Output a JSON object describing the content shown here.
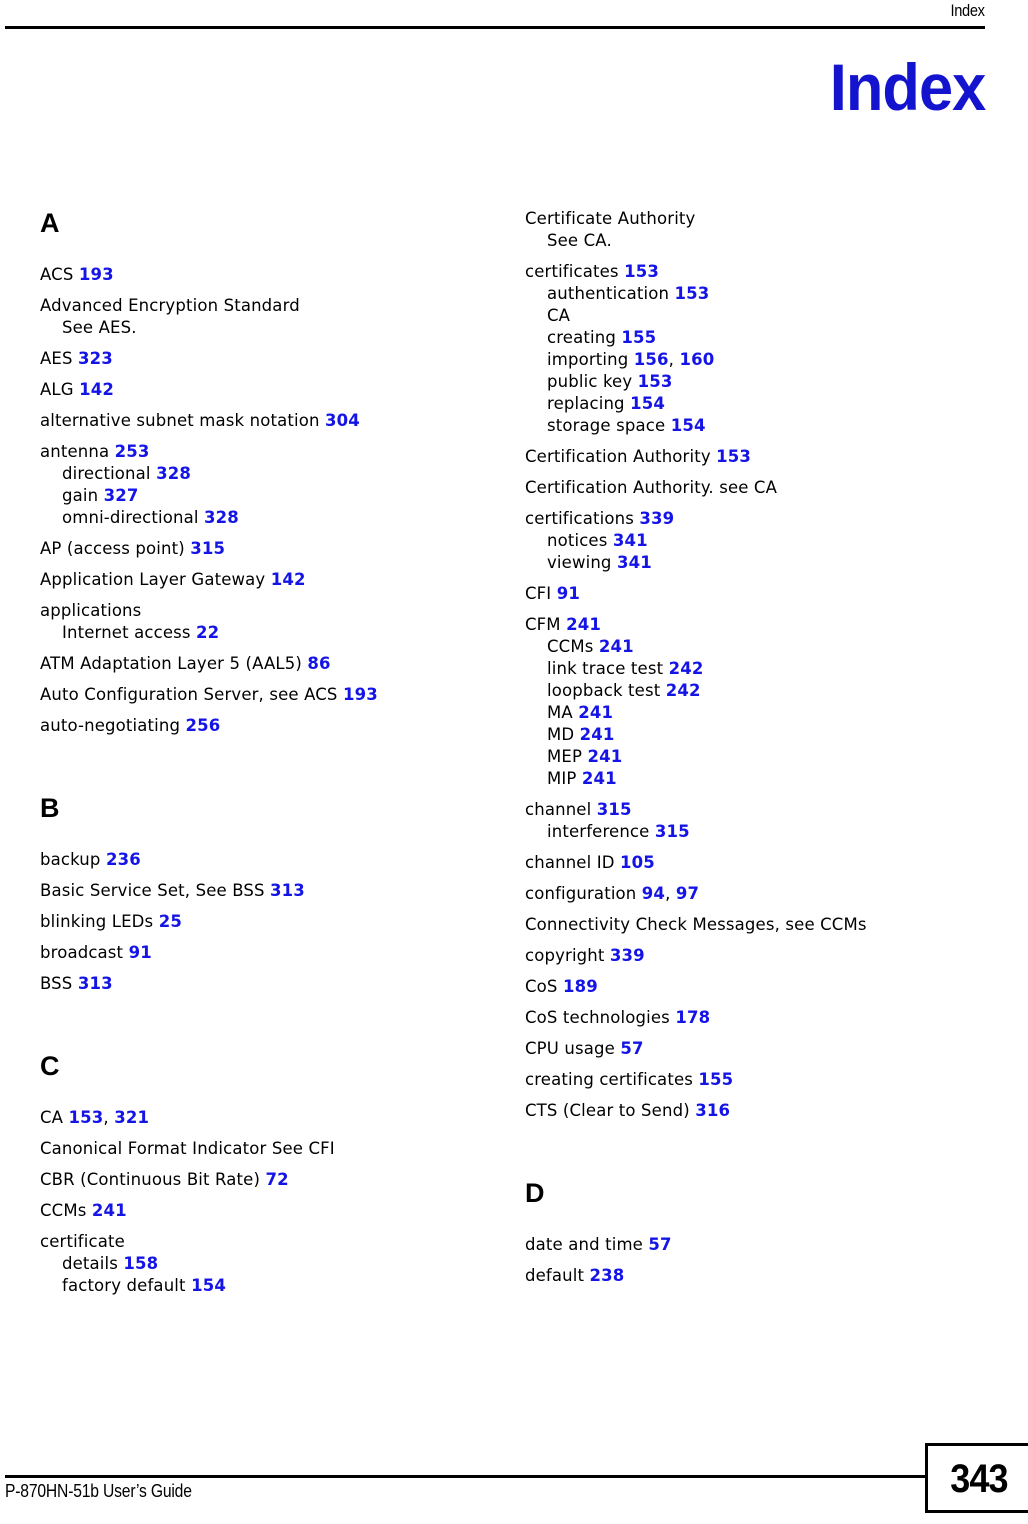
{
  "header": {
    "running_head": "Index",
    "title": "Index"
  },
  "footer": {
    "guide_name": "P-870HN-51b User’s Guide",
    "page_number": "343"
  },
  "colors": {
    "page_number_link": "#1414e6",
    "title_blue": "#1414cf",
    "text": "#000000"
  },
  "columns": [
    {
      "name": "left-column",
      "groups": [
        {
          "letter": "A",
          "entries": [
            {
              "level": 0,
              "text": "ACS ",
              "pages": [
                "193"
              ]
            },
            {
              "level": 0,
              "text": "Advanced Encryption Standard",
              "pages": []
            },
            {
              "level": 1,
              "text": "See AES.",
              "pages": []
            },
            {
              "level": 0,
              "text": "AES ",
              "pages": [
                "323"
              ]
            },
            {
              "level": 0,
              "text": "ALG ",
              "pages": [
                "142"
              ]
            },
            {
              "level": 0,
              "text": "alternative subnet mask notation ",
              "pages": [
                "304"
              ]
            },
            {
              "level": 0,
              "text": "antenna ",
              "pages": [
                "253"
              ]
            },
            {
              "level": 1,
              "text": "directional ",
              "pages": [
                "328"
              ]
            },
            {
              "level": 1,
              "text": "gain ",
              "pages": [
                "327"
              ]
            },
            {
              "level": 1,
              "text": "omni-directional ",
              "pages": [
                "328"
              ]
            },
            {
              "level": 0,
              "text": "AP (access point) ",
              "pages": [
                "315"
              ]
            },
            {
              "level": 0,
              "text": "Application Layer Gateway ",
              "pages": [
                "142"
              ]
            },
            {
              "level": 0,
              "text": "applications",
              "pages": []
            },
            {
              "level": 1,
              "text": "Internet access ",
              "pages": [
                "22"
              ]
            },
            {
              "level": 0,
              "text": "ATM Adaptation Layer 5 (AAL5) ",
              "pages": [
                "86"
              ]
            },
            {
              "level": 0,
              "text": "Auto Configuration Server, see ACS ",
              "pages": [
                "193"
              ]
            },
            {
              "level": 0,
              "text": "auto-negotiating ",
              "pages": [
                "256"
              ]
            }
          ]
        },
        {
          "letter": "B",
          "entries": [
            {
              "level": 0,
              "text": "backup ",
              "pages": [
                "236"
              ]
            },
            {
              "level": 0,
              "text": "Basic Service Set, See BSS ",
              "pages": [
                "313"
              ]
            },
            {
              "level": 0,
              "text": "blinking LEDs ",
              "pages": [
                "25"
              ]
            },
            {
              "level": 0,
              "text": "broadcast ",
              "pages": [
                "91"
              ]
            },
            {
              "level": 0,
              "text": "BSS ",
              "pages": [
                "313"
              ]
            }
          ]
        },
        {
          "letter": "C",
          "entries": [
            {
              "level": 0,
              "text": "CA ",
              "pages": [
                "153",
                "321"
              ]
            },
            {
              "level": 0,
              "text": "Canonical Format Indicator See CFI",
              "pages": []
            },
            {
              "level": 0,
              "text": "CBR (Continuous Bit Rate) ",
              "pages": [
                "72"
              ]
            },
            {
              "level": 0,
              "text": "CCMs ",
              "pages": [
                "241"
              ]
            },
            {
              "level": 0,
              "text": "certificate",
              "pages": []
            },
            {
              "level": 1,
              "text": "details ",
              "pages": [
                "158"
              ]
            },
            {
              "level": 1,
              "text": "factory default ",
              "pages": [
                "154"
              ]
            }
          ]
        }
      ]
    },
    {
      "name": "right-column",
      "groups": [
        {
          "letter": "",
          "entries": [
            {
              "level": 0,
              "text": "Certificate Authority",
              "pages": []
            },
            {
              "level": 1,
              "text": "See CA.",
              "pages": []
            },
            {
              "level": 0,
              "text": "certificates ",
              "pages": [
                "153"
              ]
            },
            {
              "level": 1,
              "text": "authentication ",
              "pages": [
                "153"
              ]
            },
            {
              "level": 1,
              "text": "CA",
              "pages": []
            },
            {
              "level": 1,
              "text": "creating ",
              "pages": [
                "155"
              ]
            },
            {
              "level": 1,
              "text": "importing ",
              "pages": [
                "156",
                "160"
              ]
            },
            {
              "level": 1,
              "text": "public key ",
              "pages": [
                "153"
              ]
            },
            {
              "level": 1,
              "text": "replacing ",
              "pages": [
                "154"
              ]
            },
            {
              "level": 1,
              "text": "storage space ",
              "pages": [
                "154"
              ]
            },
            {
              "level": 0,
              "text": "Certification Authority ",
              "pages": [
                "153"
              ]
            },
            {
              "level": 0,
              "text": "Certification Authority. see CA",
              "pages": []
            },
            {
              "level": 0,
              "text": "certifications ",
              "pages": [
                "339"
              ]
            },
            {
              "level": 1,
              "text": "notices ",
              "pages": [
                "341"
              ]
            },
            {
              "level": 1,
              "text": "viewing ",
              "pages": [
                "341"
              ]
            },
            {
              "level": 0,
              "text": "CFI ",
              "pages": [
                "91"
              ]
            },
            {
              "level": 0,
              "text": "CFM ",
              "pages": [
                "241"
              ]
            },
            {
              "level": 1,
              "text": "CCMs ",
              "pages": [
                "241"
              ]
            },
            {
              "level": 1,
              "text": "link trace test ",
              "pages": [
                "242"
              ]
            },
            {
              "level": 1,
              "text": "loopback test ",
              "pages": [
                "242"
              ]
            },
            {
              "level": 1,
              "text": "MA ",
              "pages": [
                "241"
              ]
            },
            {
              "level": 1,
              "text": "MD ",
              "pages": [
                "241"
              ]
            },
            {
              "level": 1,
              "text": "MEP ",
              "pages": [
                "241"
              ]
            },
            {
              "level": 1,
              "text": "MIP ",
              "pages": [
                "241"
              ]
            },
            {
              "level": 0,
              "text": "channel ",
              "pages": [
                "315"
              ]
            },
            {
              "level": 1,
              "text": "interference ",
              "pages": [
                "315"
              ]
            },
            {
              "level": 0,
              "text": "channel ID ",
              "pages": [
                "105"
              ]
            },
            {
              "level": 0,
              "text": "configuration ",
              "pages": [
                "94",
                "97"
              ]
            },
            {
              "level": 0,
              "text": "Connectivity Check Messages, see CCMs",
              "pages": []
            },
            {
              "level": 0,
              "text": "copyright ",
              "pages": [
                "339"
              ]
            },
            {
              "level": 0,
              "text": "CoS ",
              "pages": [
                "189"
              ]
            },
            {
              "level": 0,
              "text": "CoS technologies ",
              "pages": [
                "178"
              ]
            },
            {
              "level": 0,
              "text": "CPU usage ",
              "pages": [
                "57"
              ]
            },
            {
              "level": 0,
              "text": "creating certificates ",
              "pages": [
                "155"
              ]
            },
            {
              "level": 0,
              "text": "CTS (Clear to Send) ",
              "pages": [
                "316"
              ]
            }
          ]
        },
        {
          "letter": "D",
          "entries": [
            {
              "level": 0,
              "text": "date and time ",
              "pages": [
                "57"
              ]
            },
            {
              "level": 0,
              "text": "default ",
              "pages": [
                "238"
              ]
            }
          ]
        }
      ]
    }
  ]
}
